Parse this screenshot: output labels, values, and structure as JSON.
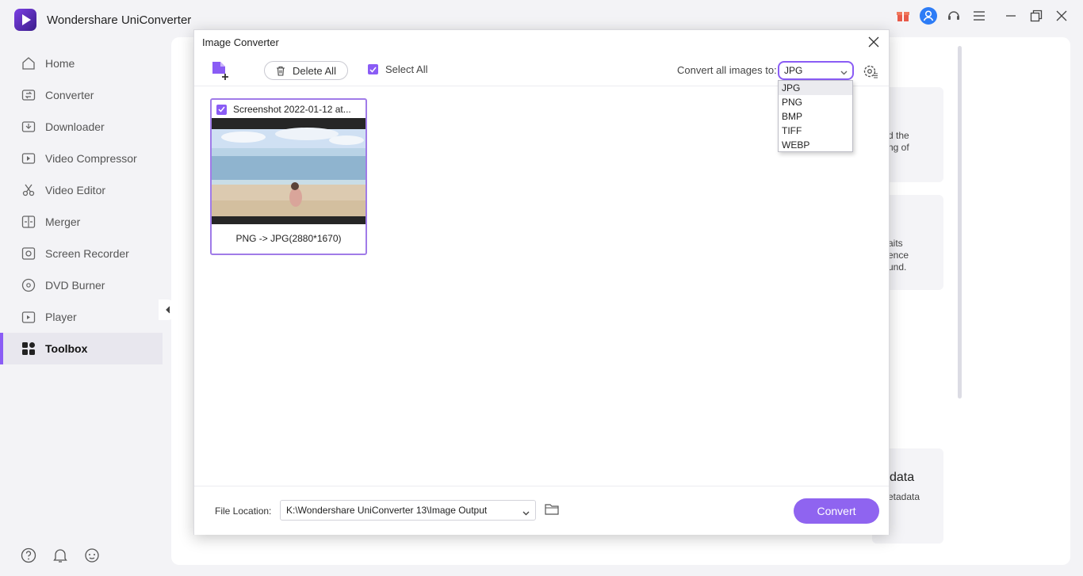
{
  "app": {
    "title": "Wondershare UniConverter"
  },
  "sidebar": {
    "items": [
      {
        "label": "Home",
        "icon": "home-icon"
      },
      {
        "label": "Converter",
        "icon": "converter-icon"
      },
      {
        "label": "Downloader",
        "icon": "downloader-icon"
      },
      {
        "label": "Video Compressor",
        "icon": "compressor-icon"
      },
      {
        "label": "Video Editor",
        "icon": "scissors-icon"
      },
      {
        "label": "Merger",
        "icon": "merger-icon"
      },
      {
        "label": "Screen Recorder",
        "icon": "screen-recorder-icon"
      },
      {
        "label": "DVD Burner",
        "icon": "disc-icon"
      },
      {
        "label": "Player",
        "icon": "player-icon"
      },
      {
        "label": "Toolbox",
        "icon": "toolbox-icon",
        "active": true
      }
    ]
  },
  "background": {
    "card1_text": [
      "d the",
      "ng of"
    ],
    "card2_text": [
      "aits",
      "ence",
      "und."
    ],
    "card3_title": "data",
    "card3_text": "etadata"
  },
  "modal": {
    "title": "Image Converter",
    "toolbar": {
      "delete_all": "Delete All",
      "select_all": "Select All",
      "convert_label": "Convert all images to:",
      "selected_format": "JPG"
    },
    "dropdown": {
      "options": [
        "JPG",
        "PNG",
        "BMP",
        "TIFF",
        "WEBP"
      ],
      "selected": "JPG"
    },
    "file": {
      "name": "Screenshot 2022-01-12 at...",
      "caption": "PNG -> JPG(2880*1670)"
    },
    "footer": {
      "file_location_label": "File Location:",
      "path": "K:\\Wondershare UniConverter 13\\Image Output",
      "convert": "Convert"
    }
  },
  "colors": {
    "accent": "#8f64f0",
    "brand": "#7b3fe4"
  }
}
